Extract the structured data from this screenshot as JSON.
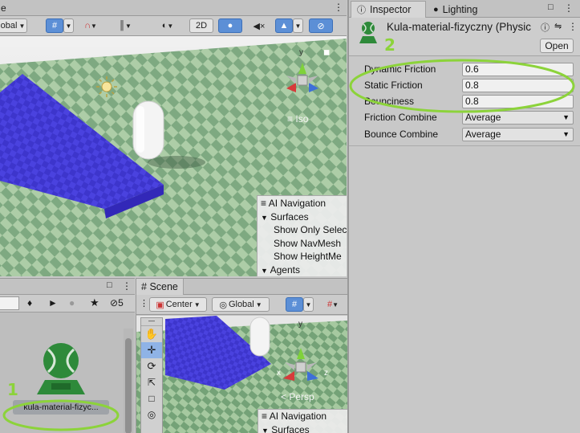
{
  "top_scene": {
    "toolbar": {
      "tab_fragment": "e",
      "global_label": "obal",
      "mode_2d": "2D"
    },
    "view_label": "Iso"
  },
  "ai_navigation_top": {
    "title": "AI Navigation",
    "section": "Surfaces",
    "items": [
      "Show Only Selec",
      "Show NavMesh",
      "Show HeightMe"
    ],
    "agents": "Agents"
  },
  "project_panel": {
    "search_count": "5",
    "asset_label": "kula-material-fizyc..."
  },
  "bottom_scene": {
    "tab_label": "Scene",
    "pivot_label": "Center",
    "space_label": "Global",
    "view_label": "Persp",
    "ai_title": "AI Navigation",
    "ai_section": "Surfaces"
  },
  "inspector": {
    "tabs": [
      {
        "label": "Inspector",
        "icon": "info-icon"
      },
      {
        "label": "Lighting",
        "icon": "bulb-icon"
      }
    ],
    "asset_title": "Kula-material-fizyczny (Physic",
    "open_button": "Open",
    "properties": [
      {
        "label": "Dynamic Friction",
        "value": "0.6",
        "kind": "field"
      },
      {
        "label": "Static Friction",
        "value": "0.8",
        "kind": "field"
      },
      {
        "label": "Bounciness",
        "value": "0.8",
        "kind": "field"
      },
      {
        "label": "Friction Combine",
        "value": "Average",
        "kind": "select"
      },
      {
        "label": "Bounce Combine",
        "value": "Average",
        "kind": "select"
      }
    ]
  },
  "annotations": {
    "label_1": "1",
    "label_2": "2",
    "highlight_color": "#8cd33a"
  },
  "colors": {
    "ramp": "#4b43e0",
    "ground_light": "#a4c89e",
    "ground_dark": "#6e9e72",
    "sky": "#ececec",
    "accent_blue": "#5c8fd6"
  }
}
